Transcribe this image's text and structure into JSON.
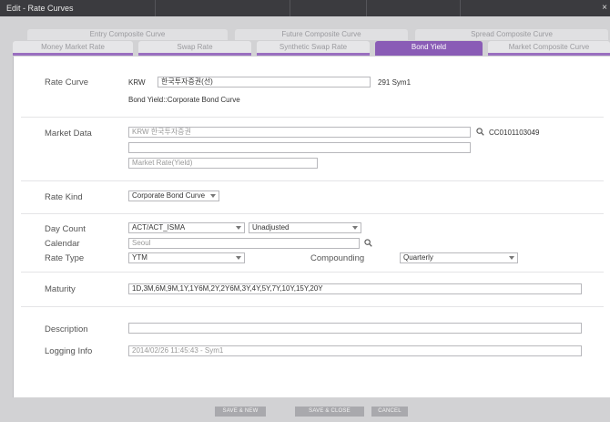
{
  "window": {
    "title": "Edit - Rate Curves",
    "close_glyph": "×"
  },
  "tabs_row1": [
    {
      "label": "Entry Composite Curve"
    },
    {
      "label": "Future Composite Curve"
    },
    {
      "label": "Spread Composite Curve"
    }
  ],
  "tabs_row2": [
    {
      "label": "Money Market Rate"
    },
    {
      "label": "Swap Rate"
    },
    {
      "label": "Synthetic Swap Rate"
    },
    {
      "label": "Bond Yield",
      "active": true
    },
    {
      "label": "Market Composite Curve"
    }
  ],
  "form": {
    "rate_curve": {
      "label": "Rate Curve",
      "currency": "KRW",
      "name_value": "한국투자증권(선)",
      "suffix": "291 Sym1",
      "subtitle": "Bond Yield::Corporate Bond Curve"
    },
    "market_data": {
      "label": "Market Data",
      "source_value": "KRW 한국투자증권",
      "code": "CC0101103049",
      "line2_value": "",
      "rate_field_value": "Market Rate(Yield)"
    },
    "rate_kind": {
      "label": "Rate Kind",
      "value": "Corporate Bond Curve"
    },
    "day_count": {
      "label": "Day Count",
      "value": "ACT/ACT_ISMA",
      "adjust_value": "Unadjusted"
    },
    "calendar": {
      "label": "Calendar",
      "value": "Seoul"
    },
    "rate_type": {
      "label": "Rate Type",
      "value": "YTM"
    },
    "compounding": {
      "label": "Compounding",
      "value": "Quarterly"
    },
    "maturity": {
      "label": "Maturity",
      "value": "1D,3M,6M,9M,1Y,1Y6M,2Y,2Y6M,3Y,4Y,5Y,7Y,10Y,15Y,20Y"
    },
    "description": {
      "label": "Description",
      "value": ""
    },
    "logging": {
      "label": "Logging Info",
      "value": "2014/02/26 11:45:43 - Sym1"
    }
  },
  "buttons": {
    "save_new": "SAVE & NEW",
    "save_close": "SAVE & CLOSE",
    "cancel": "CANCEL"
  }
}
